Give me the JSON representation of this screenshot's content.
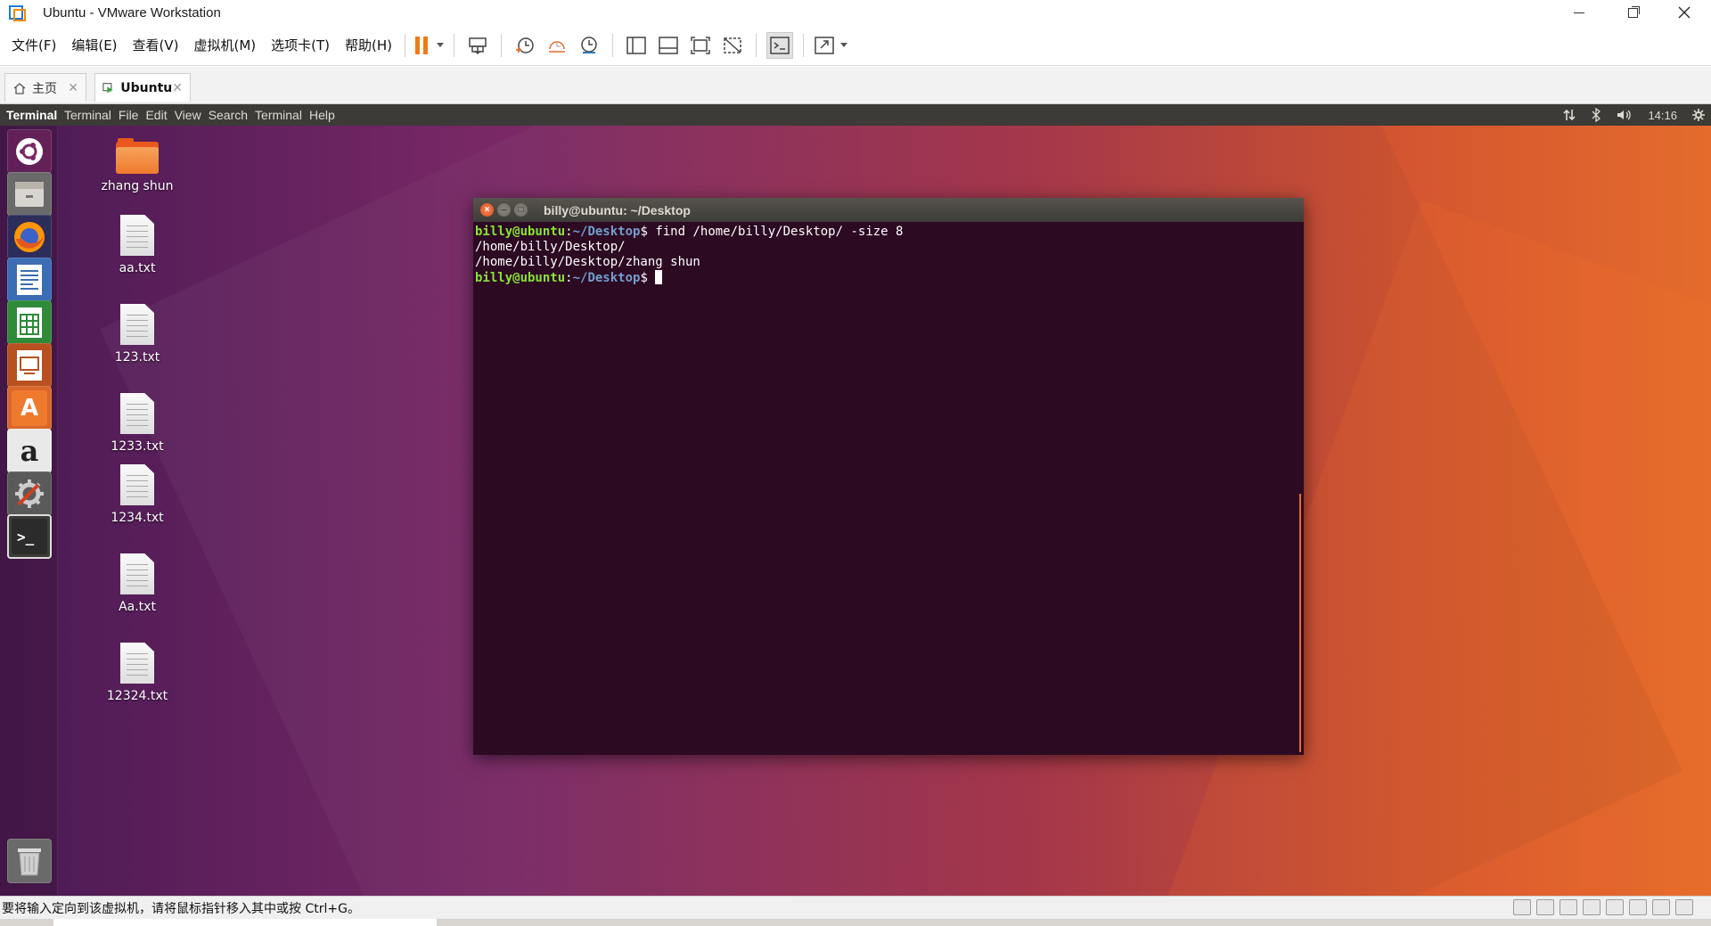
{
  "window": {
    "title": "Ubuntu - VMware Workstation"
  },
  "menubar": {
    "items": [
      "文件(F)",
      "编辑(E)",
      "查看(V)",
      "虚拟机(M)",
      "选项卡(T)",
      "帮助(H)"
    ]
  },
  "toolbar": {
    "icons": [
      "pause-icon",
      "send-keys-icon",
      "snapshot-icon",
      "revert-snapshot-icon",
      "snapshot-manager-icon",
      "show-library-icon",
      "thumbnail-bar-icon",
      "full-screen-icon",
      "unity-icon",
      "console-view-icon",
      "stretch-guest-icon"
    ]
  },
  "tabs": [
    {
      "label": "主页",
      "icon": "home-icon"
    },
    {
      "label": "Ubuntu",
      "icon": "vm-icon"
    }
  ],
  "guest": {
    "panel": {
      "app_name": "Terminal",
      "menus": [
        "Terminal",
        "File",
        "Edit",
        "View",
        "Search",
        "Terminal",
        "Help"
      ],
      "clock": "14:16",
      "indicators": [
        "network-icon",
        "bluetooth-icon",
        "volume-icon",
        "settings-gear-icon"
      ]
    },
    "launcher": [
      {
        "name": "ubuntu-dash-icon",
        "glyph": ""
      },
      {
        "name": "files-icon",
        "glyph": ""
      },
      {
        "name": "firefox-icon",
        "glyph": ""
      },
      {
        "name": "libreoffice-writer-icon",
        "glyph": ""
      },
      {
        "name": "libreoffice-calc-icon",
        "glyph": ""
      },
      {
        "name": "libreoffice-impress-icon",
        "glyph": ""
      },
      {
        "name": "software-center-icon",
        "glyph": "A"
      },
      {
        "name": "amazon-icon",
        "glyph": "a"
      },
      {
        "name": "system-settings-icon",
        "glyph": ""
      },
      {
        "name": "terminal-icon",
        "glyph": ">_"
      },
      {
        "name": "trash-icon",
        "glyph": ""
      }
    ],
    "desktop_icons": [
      {
        "label": "zhang shun",
        "type": "folder"
      },
      {
        "label": "aa.txt",
        "type": "file"
      },
      {
        "label": "123.txt",
        "type": "file"
      },
      {
        "label": "1233.txt",
        "type": "file"
      },
      {
        "label": "1234.txt",
        "type": "file"
      },
      {
        "label": "Aa.txt",
        "type": "file"
      },
      {
        "label": "12324.txt",
        "type": "file"
      }
    ],
    "terminal": {
      "title": "billy@ubuntu: ~/Desktop",
      "prompt_user": "billy@ubuntu",
      "prompt_path": "~/Desktop",
      "command": " find /home/billy/Desktop/ -size 8",
      "output": [
        "/home/billy/Desktop/",
        "/home/billy/Desktop/zhang shun"
      ]
    }
  },
  "statusbar": {
    "message": "要将输入定向到该虚拟机，请将鼠标指针移入其中或按 Ctrl+G。"
  },
  "colors": {
    "accent": "#ef7a1a",
    "terminal_bg": "#2c0a22",
    "prompt_user": "#8ae234",
    "prompt_path": "#729fcf"
  }
}
